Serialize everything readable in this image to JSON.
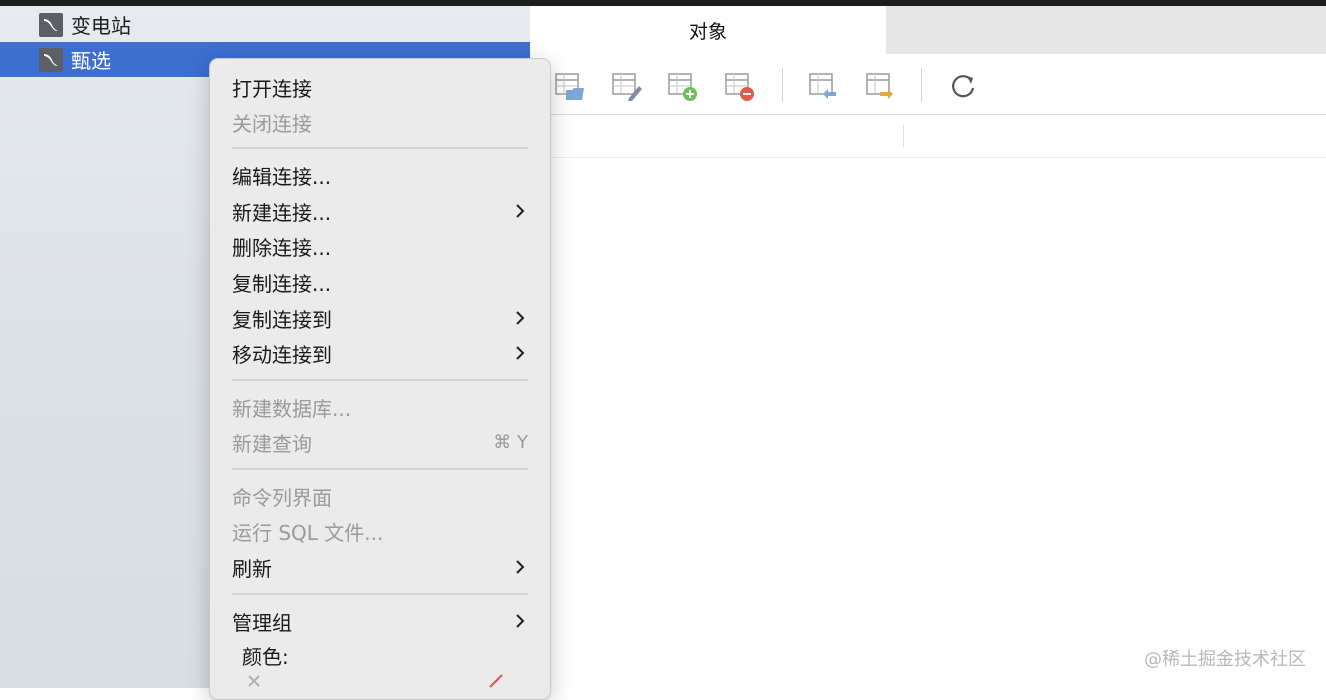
{
  "sidebar": {
    "connections": [
      {
        "label": "变电站",
        "icon": "mysql-dolphin-icon"
      },
      {
        "label": "甄选",
        "icon": "mysql-dolphin-icon"
      }
    ]
  },
  "tabs": {
    "active": "对象"
  },
  "toolbar": {
    "buttons": [
      "open-table-icon",
      "design-table-icon",
      "new-table-icon",
      "delete-table-icon",
      "import-wizard-icon",
      "export-wizard-icon",
      "refresh-icon"
    ]
  },
  "menu": {
    "open": "打开连接",
    "close": "关闭连接",
    "edit": "编辑连接...",
    "new": "新建连接...",
    "delete": "删除连接...",
    "duplicate": "复制连接...",
    "copy_to": "复制连接到",
    "move_to": "移动连接到",
    "new_db": "新建数据库...",
    "new_query": "新建查询",
    "new_query_shortcut": "⌘ Y",
    "console": "命令列界面",
    "run_sql": "运行 SQL 文件...",
    "refresh": "刷新",
    "manage_group": "管理组",
    "color_label": "颜色:"
  },
  "colors": {
    "selection": "#3d6fd0",
    "menu_bg": "#ebebeb"
  },
  "watermark": "@稀土掘金技术社区"
}
